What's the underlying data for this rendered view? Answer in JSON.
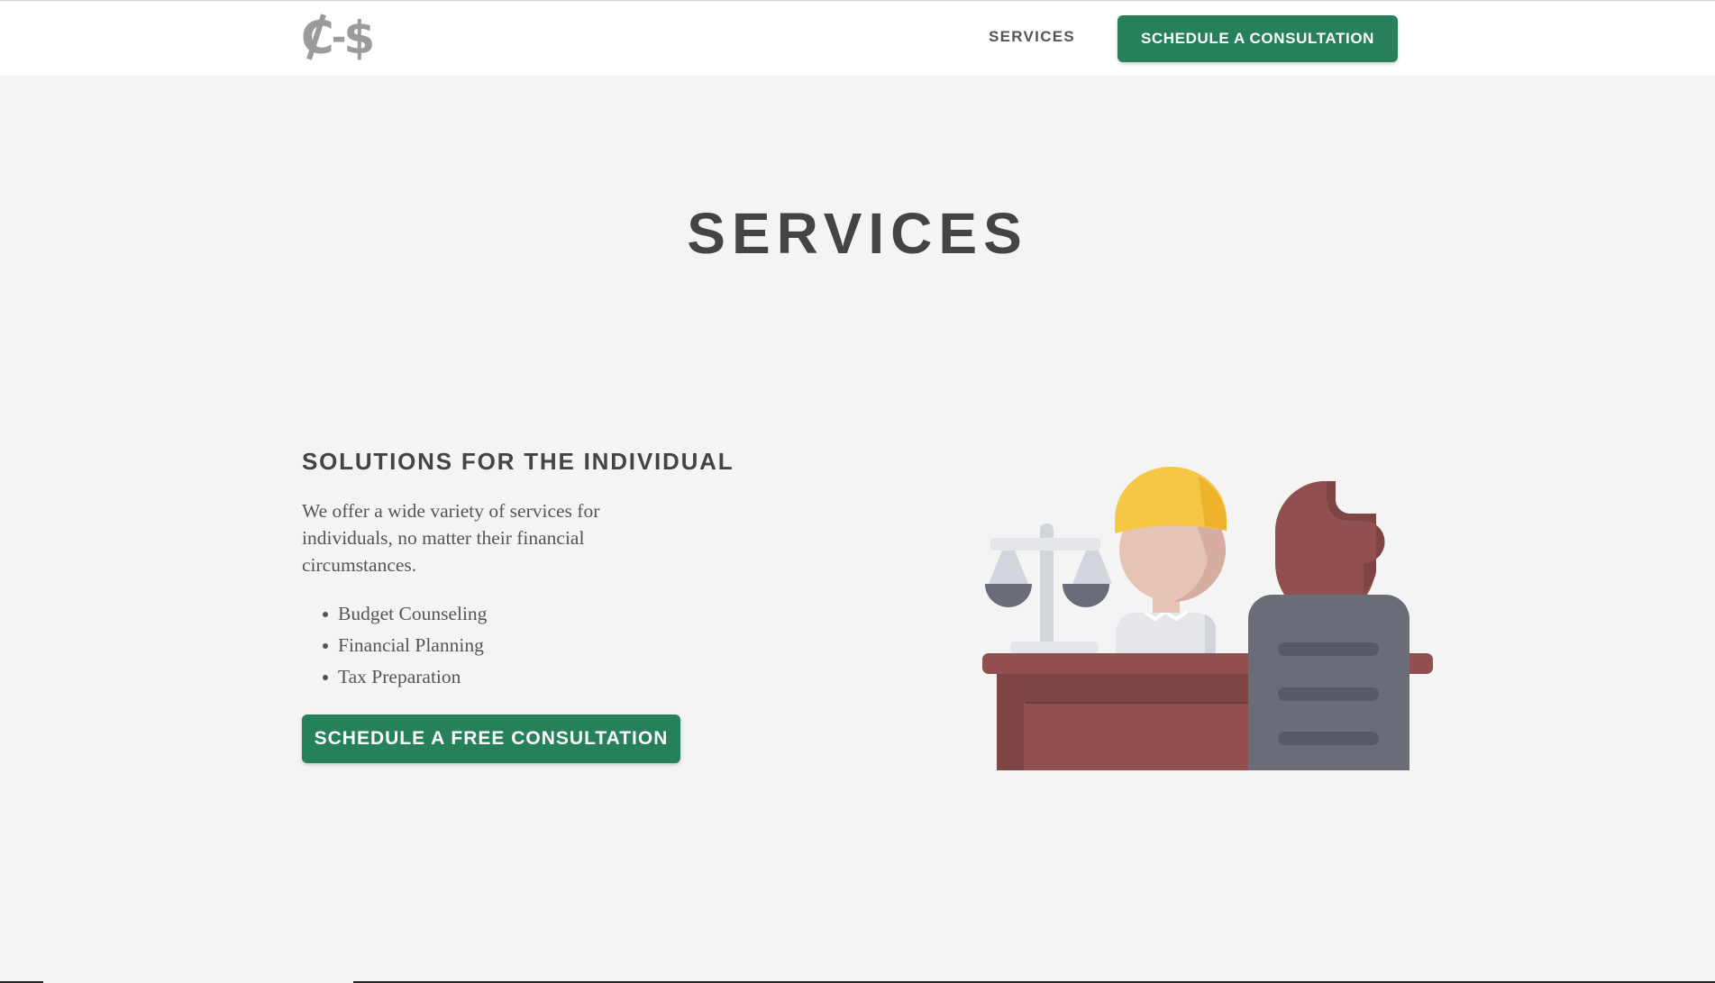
{
  "header": {
    "logo_text": "¢-$",
    "nav": {
      "services_label": "SERVICES"
    },
    "cta_label": "SCHEDULE A CONSULTATION"
  },
  "main": {
    "title": "SERVICES",
    "section": {
      "heading": "SOLUTIONS FOR THE INDIVIDUAL",
      "description": "We offer a wide variety of services for individuals, no matter their financial circumstances.",
      "services": [
        "Budget Counseling",
        "Financial Planning",
        "Tax Preparation"
      ],
      "cta_label": "SCHEDULE A FREE CONSULTATION"
    },
    "illustration": {
      "icon": "lawyer-consultation-illustration",
      "colors": {
        "hair_yellow": "#f6c744",
        "skin": "#e5c4b5",
        "desk": "#924f4f",
        "suit": "#6a6d78",
        "scale": "#d2d5db"
      }
    }
  },
  "colors": {
    "accent": "#26805a",
    "background": "#f4f4f4",
    "header_bg": "#ffffff",
    "text": "#444444"
  }
}
